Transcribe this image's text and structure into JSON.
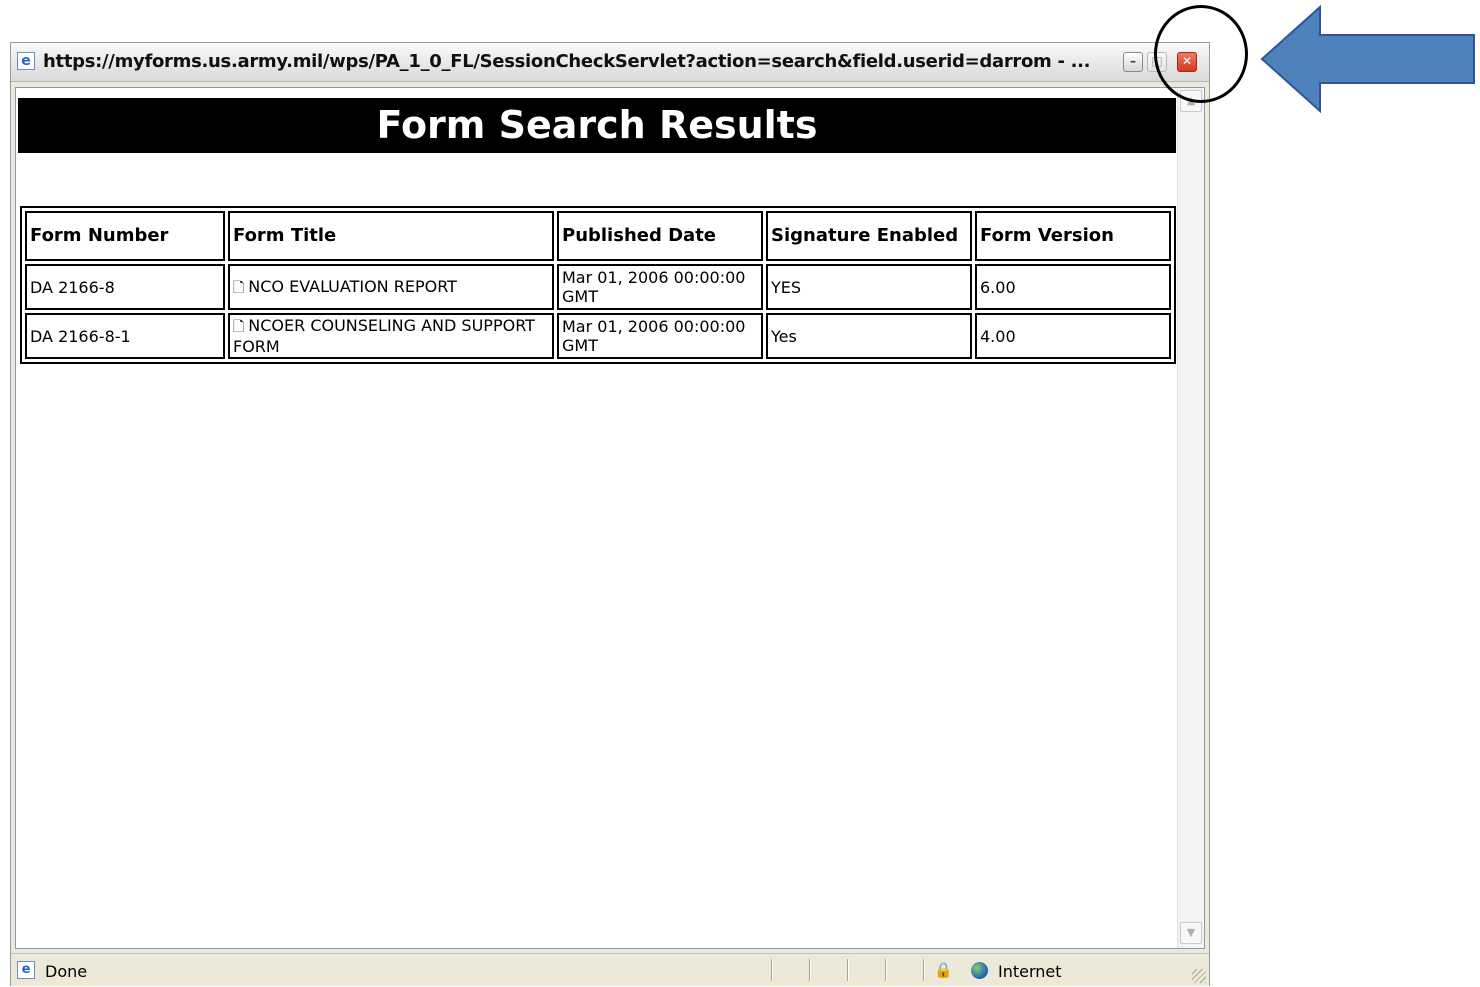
{
  "window": {
    "title": "https://myforms.us.army.mil/wps/PA_1_0_FL/SessionCheckServlet?action=search&field.userid=darrom - ...",
    "app_icon": "ie-icon",
    "controls": {
      "minimize": "minimize-icon",
      "maximize": "maximize-icon",
      "close": "close-icon"
    }
  },
  "page": {
    "banner_title": "Form Search Results",
    "table": {
      "headers": [
        "Form Number",
        "Form Title",
        "Published Date",
        "Signature Enabled",
        "Form Version"
      ],
      "rows": [
        {
          "form_number": "DA 2166-8",
          "form_title": "NCO EVALUATION REPORT",
          "published_date": "Mar 01, 2006 00:00:00 GMT",
          "signature_enabled": "YES",
          "form_version": "6.00"
        },
        {
          "form_number": "DA 2166-8-1",
          "form_title": "NCOER COUNSELING AND SUPPORT FORM",
          "published_date": "Mar 01, 2006 00:00:00 GMT",
          "signature_enabled": "Yes",
          "form_version": "4.00"
        }
      ]
    }
  },
  "statusbar": {
    "status": "Done",
    "zone": "Internet"
  },
  "annotation": {
    "arrow_color": "#4f81bd",
    "circle_color": "#000000"
  }
}
